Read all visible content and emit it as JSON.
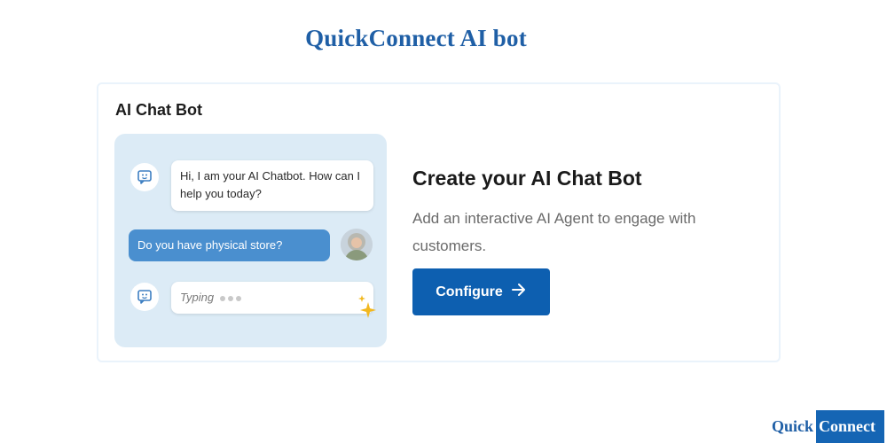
{
  "page_title": "QuickConnect AI bot",
  "card": {
    "title": "AI Chat Bot",
    "preview": {
      "bot_greeting": "Hi, I am your AI Chatbot. How can I help you today?",
      "user_message": "Do you have physical store?",
      "typing_label": "Typing"
    },
    "cta": {
      "heading": "Create your AI Chat Bot",
      "description": "Add an interactive AI Agent to engage with customers.",
      "button_label": "Configure"
    }
  },
  "brand": {
    "part1": "Quick",
    "part2": "Connect"
  },
  "colors": {
    "accent": "#0d5fb0",
    "title_blue": "#1f5fa6",
    "preview_bg": "#dcebf6",
    "user_bubble": "#4a8fcf",
    "sparkle": "#f2b81f"
  },
  "icons": [
    "chatbot-icon",
    "arrow-right-icon",
    "sparkle-icon"
  ]
}
